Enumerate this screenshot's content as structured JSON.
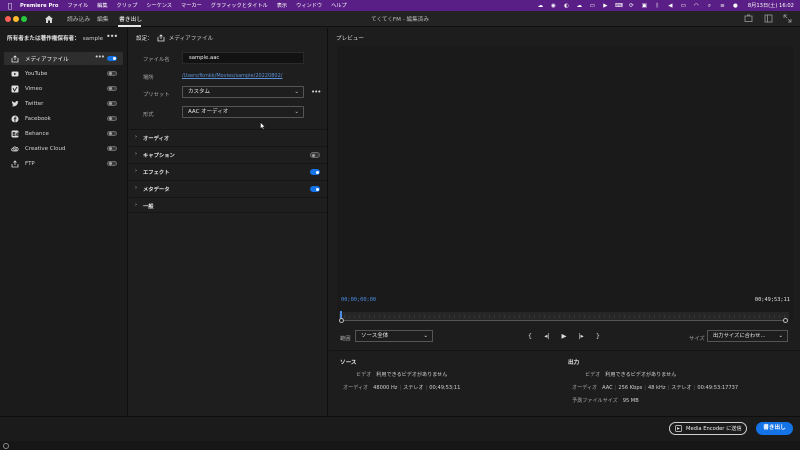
{
  "menubar": {
    "app_name": "Premiere Pro",
    "items": [
      "ファイル",
      "編集",
      "クリップ",
      "シーケンス",
      "マーカー",
      "グラフィックとタイトル",
      "表示",
      "ウィンドウ",
      "ヘルプ"
    ],
    "clock": "8月13日(土) 16:02"
  },
  "titlebar": {
    "tabs": [
      "読み込み",
      "編集",
      "書き出し"
    ],
    "active_tab": "書き出し",
    "window_title": "てくてくFM - 編集済み"
  },
  "destinations": {
    "header_label": "所有者または著作権保有者：",
    "header_value": "sample",
    "items": [
      {
        "label": "メディアファイル",
        "icon": "media-file-icon",
        "enabled": true,
        "selected": true
      },
      {
        "label": "YouTube",
        "icon": "youtube-icon",
        "enabled": false
      },
      {
        "label": "Vimeo",
        "icon": "vimeo-icon",
        "enabled": false
      },
      {
        "label": "Twitter",
        "icon": "twitter-icon",
        "enabled": false
      },
      {
        "label": "Facebook",
        "icon": "facebook-icon",
        "enabled": false
      },
      {
        "label": "Behance",
        "icon": "behance-icon",
        "enabled": false
      },
      {
        "label": "Creative Cloud",
        "icon": "creative-cloud-icon",
        "enabled": false
      },
      {
        "label": "FTP",
        "icon": "ftp-upload-icon",
        "enabled": false
      }
    ]
  },
  "settings": {
    "title": "設定：",
    "subtitle": "メディアファイル",
    "filename_label": "ファイル名",
    "filename_value": "sample.aac",
    "location_label": "場所",
    "location_value": "/Users/fkmkk/Movies/sample/20220802/",
    "preset_label": "プリセット",
    "preset_value": "カスタム",
    "format_label": "形式",
    "format_value": "AAC オーディオ",
    "sections": [
      {
        "label": "オーディオ",
        "has_toggle": false
      },
      {
        "label": "キャプション",
        "has_toggle": true,
        "enabled": false
      },
      {
        "label": "エフェクト",
        "has_toggle": true,
        "enabled": true
      },
      {
        "label": "メタデータ",
        "has_toggle": true,
        "enabled": true
      },
      {
        "label": "一般",
        "has_toggle": false
      }
    ]
  },
  "preview": {
    "title": "プレビュー",
    "timecode_start": "00;00;00;00",
    "timecode_end": "00;49;53;11",
    "range_label": "範囲",
    "range_value": "ソース全体",
    "size_label": "サイズ",
    "size_value": "出力サイズに合わせ...",
    "source": {
      "heading": "ソース",
      "video_label": "ビデオ",
      "video_value": "利用できるビデオがありません",
      "audio_label": "オーディオ",
      "audio_hz": "48000 Hz",
      "audio_ch": "ステレオ",
      "audio_dur": "00;49;53;11"
    },
    "output": {
      "heading": "出力",
      "video_label": "ビデオ",
      "video_value": "利用できるビデオがありません",
      "audio_label": "オーディオ",
      "audio_codec": "AAC",
      "audio_kbps": "256 Kbps",
      "audio_khz": "48 kHz",
      "audio_ch": "ステレオ",
      "audio_dur": "00:49:53:17737",
      "size_label": "予測ファイルサイズ",
      "size_value": "95 MB"
    }
  },
  "footer": {
    "media_encoder_label": "Media Encoder に送信",
    "export_label": "書き出し"
  },
  "colors": {
    "accent": "#1473e6",
    "timecode": "#4b8ee8",
    "menubar": "#5a1f86"
  }
}
